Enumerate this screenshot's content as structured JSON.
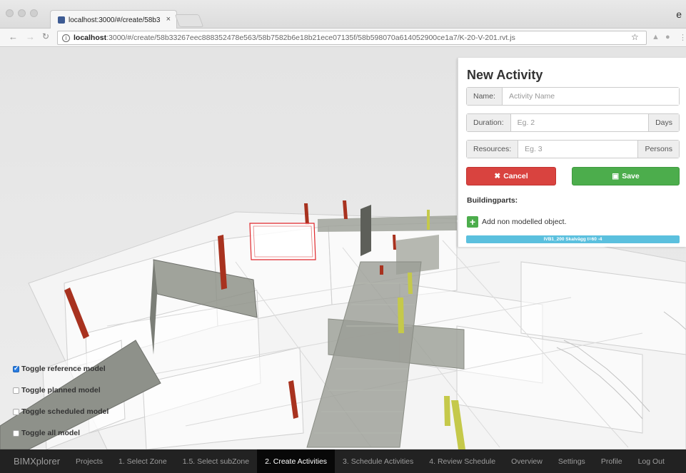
{
  "browser": {
    "tab_title": "localhost:3000/#/create/58b3",
    "tab_close": "×",
    "url_host": "localhost",
    "url_path": ":3000/#/create/58b33267eec888352478e563/58b7582b6e18b21ece07135f/58b598070a614052900ce1a7/K-20-V-201.rvt.js",
    "info_glyph": "i",
    "profile_glyph": "e"
  },
  "panel": {
    "title": "New Activity",
    "name_label": "Name:",
    "name_placeholder": "Activity Name",
    "duration_label": "Duration:",
    "duration_placeholder": "Eg. 2",
    "duration_unit": "Days",
    "resources_label": "Resources:",
    "resources_placeholder": "Eg. 3",
    "resources_unit": "Persons",
    "cancel_label": "Cancel",
    "save_label": "Save",
    "buildingparts_label": "Buildingparts:",
    "add_object_label": "Add non modelled object.",
    "buildingpart_tag": "IVB1_200 Skalvägg t=60 -4",
    "cancel_color": "#d9433f",
    "save_color": "#4cad4c"
  },
  "toggles": [
    {
      "label": "Toggle reference model",
      "checked": true
    },
    {
      "label": "Toggle planned model",
      "checked": false
    },
    {
      "label": "Toggle scheduled model",
      "checked": false
    },
    {
      "label": "Toggle all model",
      "checked": false
    }
  ],
  "navbar": {
    "brand": "BIMXplorer",
    "items": [
      "Projects",
      "1. Select Zone",
      "1.5. Select subZone",
      "2. Create Activities",
      "3. Schedule Activities",
      "4. Review Schedule",
      "Overview",
      "Settings",
      "Profile",
      "Log Out"
    ],
    "active": "2. Create Activities"
  }
}
